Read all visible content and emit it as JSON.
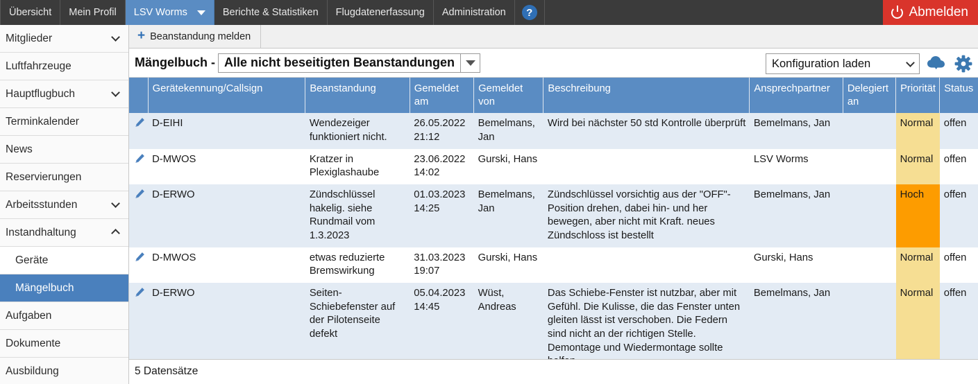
{
  "topnav": {
    "items": [
      {
        "label": "Übersicht",
        "active": false
      },
      {
        "label": "Mein Profil",
        "active": false
      },
      {
        "label": "LSV Worms",
        "active": true
      },
      {
        "label": "Berichte & Statistiken",
        "active": false
      },
      {
        "label": "Flugdatenerfassung",
        "active": false
      },
      {
        "label": "Administration",
        "active": false
      }
    ],
    "help_label": "?",
    "logout_label": "Abmelden"
  },
  "sidebar": {
    "items": [
      {
        "label": "Mitglieder",
        "chevron": "down",
        "sub": false,
        "selected": false
      },
      {
        "label": "Luftfahrzeuge",
        "chevron": "",
        "sub": false,
        "selected": false
      },
      {
        "label": "Hauptflugbuch",
        "chevron": "down",
        "sub": false,
        "selected": false
      },
      {
        "label": "Terminkalender",
        "chevron": "",
        "sub": false,
        "selected": false
      },
      {
        "label": "News",
        "chevron": "",
        "sub": false,
        "selected": false
      },
      {
        "label": "Reservierungen",
        "chevron": "",
        "sub": false,
        "selected": false
      },
      {
        "label": "Arbeitsstunden",
        "chevron": "down",
        "sub": false,
        "selected": false
      },
      {
        "label": "Instandhaltung",
        "chevron": "up",
        "sub": false,
        "selected": false
      },
      {
        "label": "Geräte",
        "chevron": "",
        "sub": true,
        "selected": false
      },
      {
        "label": "Mängelbuch",
        "chevron": "",
        "sub": true,
        "selected": true
      },
      {
        "label": "Aufgaben",
        "chevron": "",
        "sub": false,
        "selected": false
      },
      {
        "label": "Dokumente",
        "chevron": "",
        "sub": false,
        "selected": false
      },
      {
        "label": "Ausbildung",
        "chevron": "",
        "sub": false,
        "selected": false
      }
    ]
  },
  "toolbar": {
    "report_button": "Beanstandung melden",
    "plus": "+"
  },
  "title": {
    "prefix": "Mängelbuch -",
    "filter_value": "Alle nicht beseitigten Beanstandungen"
  },
  "config": {
    "select_value": "Konfiguration laden",
    "download_icon": "cloud-download-icon",
    "settings_icon": "gear-icon"
  },
  "table": {
    "columns": [
      {
        "key": "edit",
        "label": ""
      },
      {
        "key": "device",
        "label": "Gerätekennung/Callsign"
      },
      {
        "key": "complaint",
        "label": "Beanstandung"
      },
      {
        "key": "reported_on",
        "label": "Gemeldet am"
      },
      {
        "key": "reported_by",
        "label": "Gemeldet von"
      },
      {
        "key": "description",
        "label": "Beschreibung"
      },
      {
        "key": "contact",
        "label": "Ansprechpartner"
      },
      {
        "key": "delegated_to",
        "label": "Delegiert an"
      },
      {
        "key": "priority",
        "label": "Priorität"
      },
      {
        "key": "status",
        "label": "Status"
      }
    ],
    "rows": [
      {
        "device": "D-EIHI",
        "complaint": "Wendezeiger funktioniert nicht.",
        "reported_on": "26.05.2022 21:12",
        "reported_by": "Bemelmans, Jan",
        "description": "Wird bei nächster 50 std Kontrolle überprüft",
        "contact": "Bemelmans, Jan",
        "delegated_to": "",
        "priority": "Normal",
        "status": "offen"
      },
      {
        "device": "D-MWOS",
        "complaint": "Kratzer in Plexiglashaube",
        "reported_on": "23.06.2022 14:02",
        "reported_by": "Gurski, Hans",
        "description": "",
        "contact": "LSV Worms",
        "delegated_to": "",
        "priority": "Normal",
        "status": "offen"
      },
      {
        "device": "D-ERWO",
        "complaint": "Zündschlüssel hakelig. siehe Rundmail vom 1.3.2023",
        "reported_on": "01.03.2023 14:25",
        "reported_by": "Bemelmans, Jan",
        "description": "Zündschlüssel vorsichtig aus der \"OFF\"-Position drehen, dabei hin- und her bewegen, aber nicht mit Kraft. neues Zündschloss ist bestellt",
        "contact": "Bemelmans, Jan",
        "delegated_to": "",
        "priority": "Hoch",
        "status": "offen"
      },
      {
        "device": "D-MWOS",
        "complaint": "etwas reduzierte Bremswirkung",
        "reported_on": "31.03.2023 19:07",
        "reported_by": "Gurski, Hans",
        "description": "",
        "contact": "Gurski, Hans",
        "delegated_to": "",
        "priority": "Normal",
        "status": "offen"
      },
      {
        "device": "D-ERWO",
        "complaint": "Seiten-Schiebefenster auf der Pilotenseite defekt",
        "reported_on": "05.04.2023 14:45",
        "reported_by": "Wüst, Andreas",
        "description": "Das Schiebe-Fenster ist nutzbar, aber mit Gefühl. Die Kulisse, die das Fenster unten gleiten lässt ist verschoben. Die Federn sind nicht an der richtigen Stelle. Demontage und Wiedermontage sollte helfen.",
        "contact": "Bemelmans, Jan",
        "delegated_to": "",
        "priority": "Normal",
        "status": "offen"
      }
    ]
  },
  "footer": {
    "record_count": "5 Datensätze"
  },
  "colors": {
    "nav_bg": "#3b3b3b",
    "accent_blue": "#5a8cc3",
    "logout_red": "#d9342b",
    "priority_normal": "#f6de93",
    "priority_high": "#fd9c00",
    "row_odd": "#e3ebf4"
  }
}
